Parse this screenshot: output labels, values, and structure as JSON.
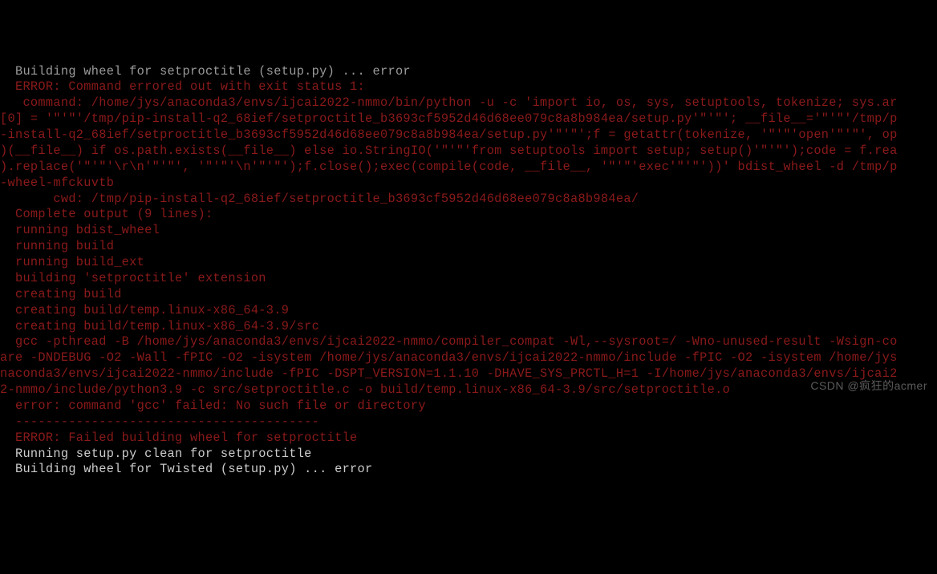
{
  "lines": [
    {
      "cls": "dim-white",
      "text": "  Building wheel for setproctitle (setup.py) ... error"
    },
    {
      "cls": "error",
      "text": "  ERROR: Command errored out with exit status 1:"
    },
    {
      "cls": "error",
      "text": "   command: /home/jys/anaconda3/envs/ijcai2022-nmmo/bin/python -u -c 'import io, os, sys, setuptools, tokenize; sys.ar"
    },
    {
      "cls": "error",
      "text": "[0] = '\"'\"'/tmp/pip-install-q2_68ief/setproctitle_b3693cf5952d46d68ee079c8a8b984ea/setup.py'\"'\"'; __file__='\"'\"'/tmp/p"
    },
    {
      "cls": "error",
      "text": "-install-q2_68ief/setproctitle_b3693cf5952d46d68ee079c8a8b984ea/setup.py'\"'\"';f = getattr(tokenize, '\"'\"'open'\"'\"', op"
    },
    {
      "cls": "error",
      "text": ")(__file__) if os.path.exists(__file__) else io.StringIO('\"'\"'from setuptools import setup; setup()'\"'\"');code = f.rea"
    },
    {
      "cls": "error",
      "text": ").replace('\"'\"'\\r\\n'\"'\"', '\"'\"'\\n'\"'\"');f.close();exec(compile(code, __file__, '\"'\"'exec'\"'\"'))' bdist_wheel -d /tmp/p"
    },
    {
      "cls": "error",
      "text": "-wheel-mfckuvtb"
    },
    {
      "cls": "error",
      "text": "       cwd: /tmp/pip-install-q2_68ief/setproctitle_b3693cf5952d46d68ee079c8a8b984ea/"
    },
    {
      "cls": "error",
      "text": "  Complete output (9 lines):"
    },
    {
      "cls": "error",
      "text": "  running bdist_wheel"
    },
    {
      "cls": "error",
      "text": "  running build"
    },
    {
      "cls": "error",
      "text": "  running build_ext"
    },
    {
      "cls": "error",
      "text": "  building 'setproctitle' extension"
    },
    {
      "cls": "error",
      "text": "  creating build"
    },
    {
      "cls": "error",
      "text": "  creating build/temp.linux-x86_64-3.9"
    },
    {
      "cls": "error",
      "text": "  creating build/temp.linux-x86_64-3.9/src"
    },
    {
      "cls": "error",
      "text": "  gcc -pthread -B /home/jys/anaconda3/envs/ijcai2022-nmmo/compiler_compat -Wl,--sysroot=/ -Wno-unused-result -Wsign-co"
    },
    {
      "cls": "error",
      "text": "are -DNDEBUG -O2 -Wall -fPIC -O2 -isystem /home/jys/anaconda3/envs/ijcai2022-nmmo/include -fPIC -O2 -isystem /home/jys"
    },
    {
      "cls": "error",
      "text": "naconda3/envs/ijcai2022-nmmo/include -fPIC -DSPT_VERSION=1.1.10 -DHAVE_SYS_PRCTL_H=1 -I/home/jys/anaconda3/envs/ijcai2"
    },
    {
      "cls": "error",
      "text": "2-nmmo/include/python3.9 -c src/setproctitle.c -o build/temp.linux-x86_64-3.9/src/setproctitle.o"
    },
    {
      "cls": "error",
      "text": "  error: command 'gcc' failed: No such file or directory"
    },
    {
      "cls": "error",
      "text": "  ----------------------------------------"
    },
    {
      "cls": "error",
      "text": "  ERROR: Failed building wheel for setproctitle"
    },
    {
      "cls": "white",
      "text": "  Running setup.py clean for setproctitle"
    },
    {
      "cls": "white",
      "text": "  Building wheel for Twisted (setup.py) ... error"
    }
  ],
  "watermark": "CSDN @疯狂的acmer"
}
